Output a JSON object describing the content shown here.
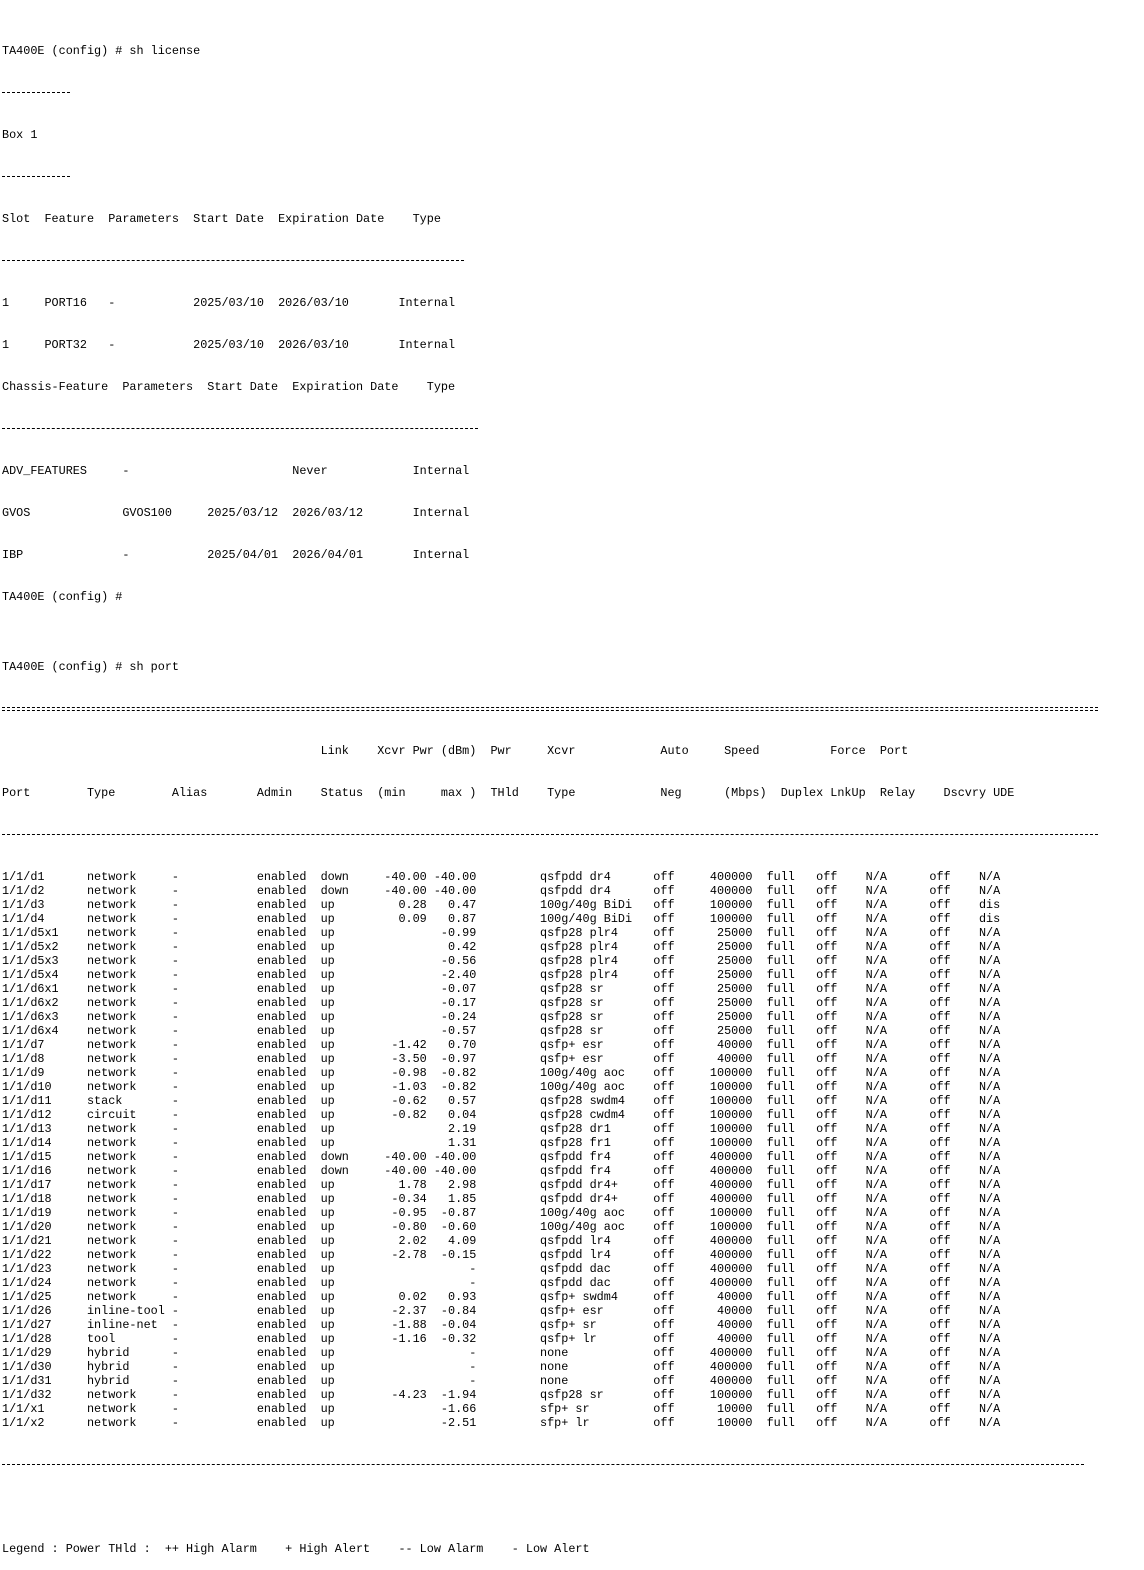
{
  "terminal": {
    "license": {
      "command": "TA400E (config) # sh license",
      "box_label": "Box 1",
      "slot_header": "Slot  Feature  Parameters  Start Date  Expiration Date    Type",
      "slot_rows": [
        "1     PORT16   -           2025/03/10  2026/03/10       Internal",
        "1     PORT32   -           2025/03/10  2026/03/10       Internal"
      ],
      "chassis_header": "Chassis-Feature  Parameters  Start Date  Expiration Date    Type",
      "chassis_rows": [
        "ADV_FEATURES     -                       Never            Internal",
        "GVOS             GVOS100     2025/03/12  2026/03/12       Internal",
        "IBP              -           2025/04/01  2026/04/01       Internal"
      ],
      "prompt": "TA400E (config) #"
    },
    "ports": {
      "command": "TA400E (config) # sh port",
      "header_line1": "                                             Link    Xcvr Pwr (dBm)  Pwr     Xcvr            Auto     Speed          Force  Port",
      "header_line2": "Port        Type        Alias       Admin    Status  (min     max )  THld    Type            Neg      (Mbps)  Duplex LnkUp  Relay    Dscvry UDE",
      "rows": [
        "1/1/d1      network     -           enabled  down     -40.00 -40.00         qsfpdd dr4      off     400000  full   off    N/A      off    N/A",
        "1/1/d2      network     -           enabled  down     -40.00 -40.00         qsfpdd dr4      off     400000  full   off    N/A      off    N/A",
        "1/1/d3      network     -           enabled  up         0.28   0.47         100g/40g BiDi   off     100000  full   off    N/A      off    dis",
        "1/1/d4      network     -           enabled  up         0.09   0.87         100g/40g BiDi   off     100000  full   off    N/A      off    dis",
        "1/1/d5x1    network     -           enabled  up               -0.99         qsfp28 plr4     off      25000  full   off    N/A      off    N/A",
        "1/1/d5x2    network     -           enabled  up                0.42         qsfp28 plr4     off      25000  full   off    N/A      off    N/A",
        "1/1/d5x3    network     -           enabled  up               -0.56         qsfp28 plr4     off      25000  full   off    N/A      off    N/A",
        "1/1/d5x4    network     -           enabled  up               -2.40         qsfp28 plr4     off      25000  full   off    N/A      off    N/A",
        "1/1/d6x1    network     -           enabled  up               -0.07         qsfp28 sr       off      25000  full   off    N/A      off    N/A",
        "1/1/d6x2    network     -           enabled  up               -0.17         qsfp28 sr       off      25000  full   off    N/A      off    N/A",
        "1/1/d6x3    network     -           enabled  up               -0.24         qsfp28 sr       off      25000  full   off    N/A      off    N/A",
        "1/1/d6x4    network     -           enabled  up               -0.57         qsfp28 sr       off      25000  full   off    N/A      off    N/A",
        "1/1/d7      network     -           enabled  up        -1.42   0.70         qsfp+ esr       off      40000  full   off    N/A      off    N/A",
        "1/1/d8      network     -           enabled  up        -3.50  -0.97         qsfp+ esr       off      40000  full   off    N/A      off    N/A",
        "1/1/d9      network     -           enabled  up        -0.98  -0.82         100g/40g aoc    off     100000  full   off    N/A      off    N/A",
        "1/1/d10     network     -           enabled  up        -1.03  -0.82         100g/40g aoc    off     100000  full   off    N/A      off    N/A",
        "1/1/d11     stack       -           enabled  up        -0.62   0.57         qsfp28 swdm4    off     100000  full   off    N/A      off    N/A",
        "1/1/d12     circuit     -           enabled  up        -0.82   0.04         qsfp28 cwdm4    off     100000  full   off    N/A      off    N/A",
        "1/1/d13     network     -           enabled  up                2.19         qsfp28 dr1      off     100000  full   off    N/A      off    N/A",
        "1/1/d14     network     -           enabled  up                1.31         qsfp28 fr1      off     100000  full   off    N/A      off    N/A",
        "1/1/d15     network     -           enabled  down     -40.00 -40.00         qsfpdd fr4      off     400000  full   off    N/A      off    N/A",
        "1/1/d16     network     -           enabled  down     -40.00 -40.00         qsfpdd fr4      off     400000  full   off    N/A      off    N/A",
        "1/1/d17     network     -           enabled  up         1.78   2.98         qsfpdd dr4+     off     400000  full   off    N/A      off    N/A",
        "1/1/d18     network     -           enabled  up        -0.34   1.85         qsfpdd dr4+     off     400000  full   off    N/A      off    N/A",
        "1/1/d19     network     -           enabled  up        -0.95  -0.87         100g/40g aoc    off     100000  full   off    N/A      off    N/A",
        "1/1/d20     network     -           enabled  up        -0.80  -0.60         100g/40g aoc    off     100000  full   off    N/A      off    N/A",
        "1/1/d21     network     -           enabled  up         2.02   4.09         qsfpdd lr4      off     400000  full   off    N/A      off    N/A",
        "1/1/d22     network     -           enabled  up        -2.78  -0.15         qsfpdd lr4      off     400000  full   off    N/A      off    N/A",
        "1/1/d23     network     -           enabled  up                   -         qsfpdd dac      off     400000  full   off    N/A      off    N/A",
        "1/1/d24     network     -           enabled  up                   -         qsfpdd dac      off     400000  full   off    N/A      off    N/A",
        "1/1/d25     network     -           enabled  up         0.02   0.93         qsfp+ swdm4     off      40000  full   off    N/A      off    N/A",
        "1/1/d26     inline-tool -           enabled  up        -2.37  -0.84         qsfp+ esr       off      40000  full   off    N/A      off    N/A",
        "1/1/d27     inline-net  -           enabled  up        -1.88  -0.04         qsfp+ sr        off      40000  full   off    N/A      off    N/A",
        "1/1/d28     tool        -           enabled  up        -1.16  -0.32         qsfp+ lr        off      40000  full   off    N/A      off    N/A",
        "1/1/d29     hybrid      -           enabled  up                   -         none            off     400000  full   off    N/A      off    N/A",
        "1/1/d30     hybrid      -           enabled  up                   -         none            off     400000  full   off    N/A      off    N/A",
        "1/1/d31     hybrid      -           enabled  up                   -         none            off     400000  full   off    N/A      off    N/A",
        "1/1/d32     network     -           enabled  up        -4.23  -1.94         qsfp28 sr       off     100000  full   off    N/A      off    N/A",
        "1/1/x1      network     -           enabled  up               -1.66         sfp+ sr         off      10000  full   off    N/A      off    N/A",
        "1/1/x2      network     -           enabled  up               -2.51         sfp+ lr         off      10000  full   off    N/A      off    N/A"
      ],
      "legend": "Legend : Power THld :  ++ High Alarm    + High Alert    -- Low Alarm    - Low Alert"
    }
  }
}
